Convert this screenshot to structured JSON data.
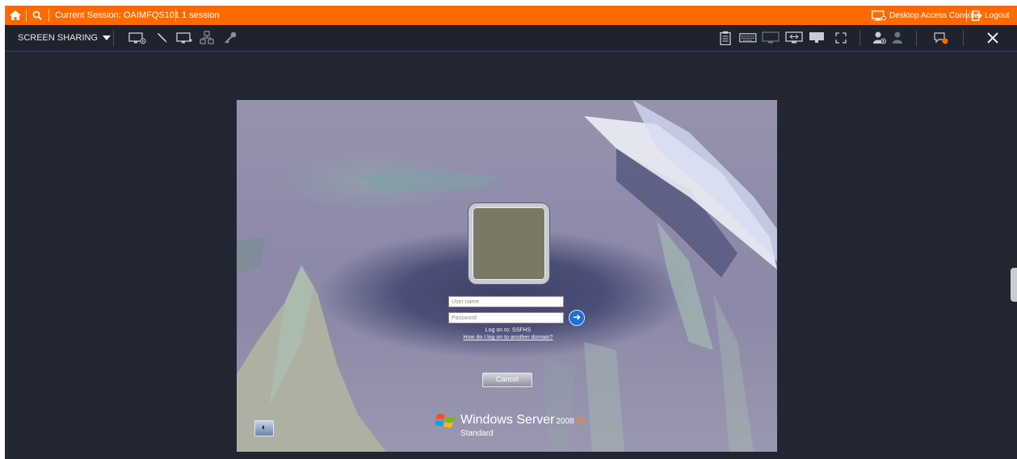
{
  "topbar": {
    "session_label": "Current Session: OAIMFQS101",
    "session_count": "1 session",
    "desktop_access_label": "Desktop Access Console",
    "logout_label": "Logout"
  },
  "toolbar": {
    "screen_sharing_label": "SCREEN SHARING"
  },
  "remote": {
    "username_placeholder": "User name",
    "password_placeholder": "Password",
    "logon_to": "Log on to: SSFHS",
    "domain_link": "How do I log on to another domain?",
    "cancel_label": "Cancel",
    "brand_name": "Windows Server",
    "brand_version": "2008",
    "brand_r2": "R2",
    "brand_edition": "Standard"
  },
  "colors": {
    "accent": "#ff6a00",
    "app_background": "#222633",
    "toolbar_background": "#1f2330"
  },
  "icons": [
    "home-icon",
    "search-icon",
    "caret-down-icon",
    "monitor-play-icon",
    "pen-icon",
    "monitor-icon",
    "network-icon",
    "key-icon",
    "clipboard-icon",
    "keyboard-icon",
    "monitor-off-icon",
    "monitor-send-icon",
    "display-icon",
    "fullscreen-icon",
    "add-user-icon",
    "user-icon",
    "chat-icon",
    "close-icon",
    "monitor-screen-icon",
    "logout-icon",
    "ease-of-access-icon",
    "windows-logo-icon",
    "go-arrow-icon"
  ]
}
